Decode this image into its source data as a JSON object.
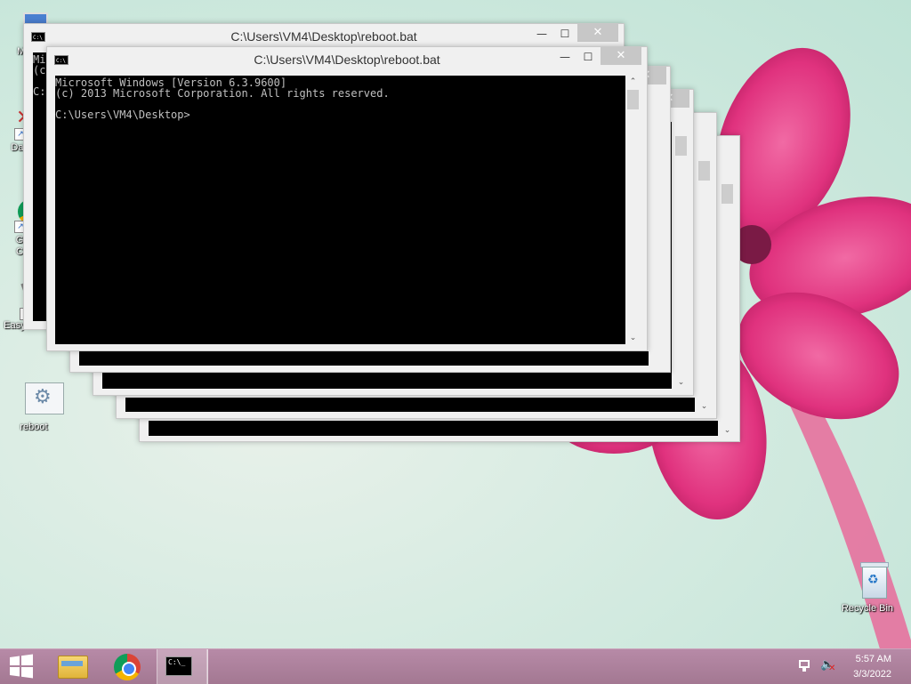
{
  "desktop": {
    "icons": [
      {
        "label": "My C",
        "name": "my-computer"
      },
      {
        "label": "Data",
        "name": "data"
      },
      {
        "label": "G\nC",
        "name": "google-chrome"
      },
      {
        "label": "EasyBCD",
        "name": "easybcd"
      },
      {
        "label": "reboot",
        "name": "reboot"
      },
      {
        "label": "Recycle Bin",
        "name": "recycle-bin"
      }
    ]
  },
  "windows": {
    "title": "C:\\Users\\VM4\\Desktop\\reboot.bat",
    "close_glyph": "✕",
    "min_glyph": "—",
    "max_glyph": "☐",
    "front_console_text": "Microsoft Windows [Version 6.3.9600]\n(c) 2013 Microsoft Corporation. All rights reserved.\n\nC:\\Users\\VM4\\Desktop>",
    "back_console_text": "Mi\n(c\n\nC:"
  },
  "taskbar": {
    "items": [
      "start-button",
      "file-explorer",
      "chrome",
      "command-prompt"
    ],
    "time": "5:57 AM",
    "date": "3/3/2022"
  },
  "colors": {
    "taskbar": "#a87d98",
    "console_bg": "#000000",
    "console_fg": "#c0c0c0",
    "flower": "#e0327e"
  }
}
